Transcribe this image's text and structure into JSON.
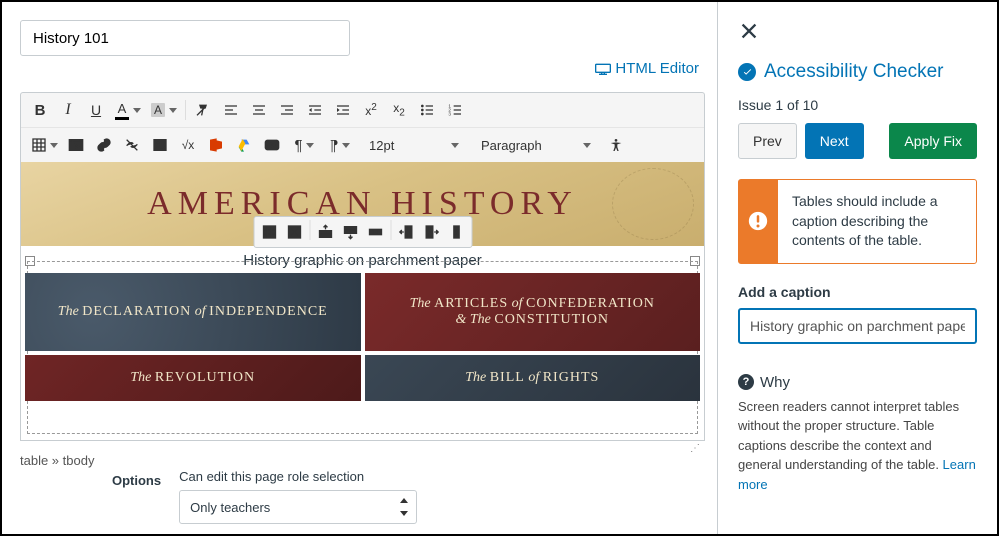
{
  "title_input": "History 101",
  "html_editor_link": "HTML Editor",
  "toolbar": {
    "font_size": "12pt",
    "block_format": "Paragraph"
  },
  "content": {
    "banner_title": "AMERICAN HISTORY",
    "table_caption": "History graphic on parchment paper",
    "cells": {
      "c1_a": "The ",
      "c1_b": "DECLARATION",
      "c1_c": " of ",
      "c1_d": "INDEPENDENCE",
      "c2_a": "The ",
      "c2_b": "ARTICLES",
      "c2_c": " of ",
      "c2_d": "CONFEDERATION",
      "c2_e": "& The ",
      "c2_f": "CONSTITUTION",
      "c3_a": "The ",
      "c3_b": "REVOLUTION",
      "c4_a": "The ",
      "c4_b": "BILL",
      "c4_c": " of ",
      "c4_d": "RIGHTS"
    },
    "element_path": "table » tbody"
  },
  "options": {
    "section_label": "Options",
    "role_text": "Can edit this page role selection",
    "role_selected": "Only teachers"
  },
  "panel": {
    "title": "Accessibility Checker",
    "issue_counter": "Issue 1 of 10",
    "prev": "Prev",
    "next": "Next",
    "apply": "Apply Fix",
    "issue_message": "Tables should include a caption describing the contents of the table.",
    "caption_label": "Add a caption",
    "caption_value": "History graphic on parchment paper",
    "why_heading": "Why",
    "why_body": "Screen readers cannot interpret tables without the proper structure. Table captions describe the context and general understanding of the table. ",
    "learn_more": "Learn more"
  }
}
